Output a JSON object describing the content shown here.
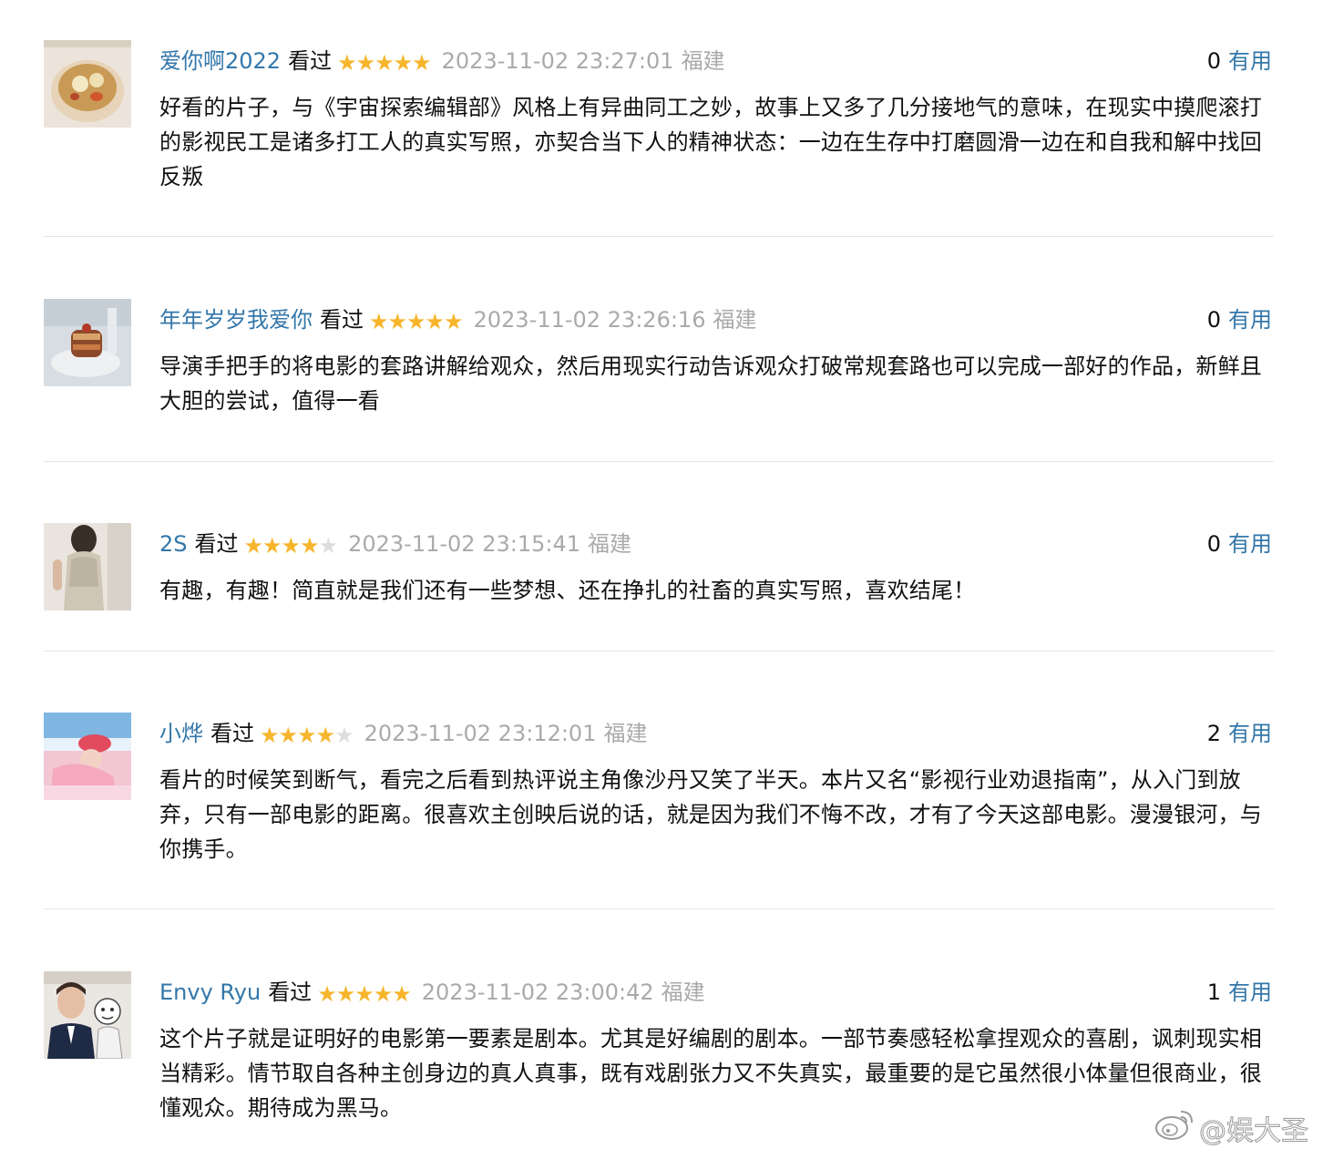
{
  "comments": [
    {
      "user": "爱你啊2022",
      "status": "看过",
      "rating": 5,
      "time": "2023-11-02 23:27:01",
      "location": "福建",
      "votes": "0",
      "useful_label": "有用",
      "text": "好看的片子，与《宇宙探索编辑部》风格上有异曲同工之妙，故事上又多了几分接地气的意味，在现实中摸爬滚打的影视民工是诸多打工人的真实写照，亦契合当下人的精神状态：一边在生存中打磨圆滑一边在和自我和解中找回反叛"
    },
    {
      "user": "年年岁岁我爱你",
      "status": "看过",
      "rating": 5,
      "time": "2023-11-02 23:26:16",
      "location": "福建",
      "votes": "0",
      "useful_label": "有用",
      "text": "导演手把手的将电影的套路讲解给观众，然后用现实行动告诉观众打破常规套路也可以完成一部好的作品，新鲜且大胆的尝试，值得一看"
    },
    {
      "user": "2S",
      "status": "看过",
      "rating": 4,
      "time": "2023-11-02 23:15:41",
      "location": "福建",
      "votes": "0",
      "useful_label": "有用",
      "text": "有趣，有趣！简直就是我们还有一些梦想、还在挣扎的社畜的真实写照，喜欢结尾！"
    },
    {
      "user": "小烨",
      "status": "看过",
      "rating": 4,
      "time": "2023-11-02 23:12:01",
      "location": "福建",
      "votes": "2",
      "useful_label": "有用",
      "text": "看片的时候笑到断气，看完之后看到热评说主角像沙丹又笑了半天。本片又名“影视行业劝退指南”，从入门到放弃，只有一部电影的距离。很喜欢主创映后说的话，就是因为我们不悔不改，才有了今天这部电影。漫漫银河，与你携手。"
    },
    {
      "user": "Envy Ryu",
      "status": "看过",
      "rating": 5,
      "time": "2023-11-02 23:00:42",
      "location": "福建",
      "votes": "1",
      "useful_label": "有用",
      "text": "这个片子就是证明好的电影第一要素是剧本。尤其是好编剧的剧本。一部节奏感轻松拿捏观众的喜剧，讽刺现实相当精彩。情节取自各种主创身边的真人真事，既有戏剧张力又不失真实，最重要的是它虽然很小体量但很商业，很懂观众。期待成为黑马。"
    }
  ],
  "watermark": "@娱大圣",
  "colors": {
    "link": "#3377aa",
    "star": "#f7b52c",
    "muted": "#aaaaaa"
  }
}
